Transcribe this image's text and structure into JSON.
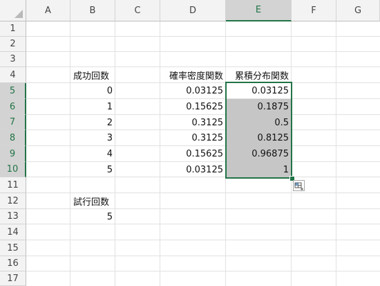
{
  "sheet": {
    "columns": [
      "A",
      "B",
      "C",
      "D",
      "E",
      "F",
      "G"
    ],
    "selected_column": "E",
    "rows": [
      "1",
      "2",
      "3",
      "4",
      "5",
      "6",
      "7",
      "8",
      "9",
      "10",
      "11",
      "12",
      "13",
      "14",
      "15",
      "16",
      "17"
    ],
    "selected_rows": [
      "5",
      "6",
      "7",
      "8",
      "9",
      "10"
    ]
  },
  "cells": {
    "b4": "成功回数",
    "d4": "確率密度関数",
    "e4": "累積分布関数",
    "b5": "0",
    "d5": "0.03125",
    "e5": "0.03125",
    "b6": "1",
    "d6": "0.15625",
    "e6": "0.1875",
    "b7": "2",
    "d7": "0.3125",
    "e7": "0.5",
    "b8": "3",
    "d8": "0.3125",
    "e8": "0.8125",
    "b9": "4",
    "d9": "0.15625",
    "e9": "0.96875",
    "b10": "5",
    "d10": "0.03125",
    "e10": "1",
    "b12": "試行回数",
    "b13": "5"
  },
  "icons": {
    "select_all": "select-all-triangle-icon",
    "quick_analysis": "quick-analysis-icon"
  },
  "colors": {
    "selection_border": "#217346",
    "selection_fill": "#c6c6c6",
    "header_bg": "#f3f3f3"
  }
}
